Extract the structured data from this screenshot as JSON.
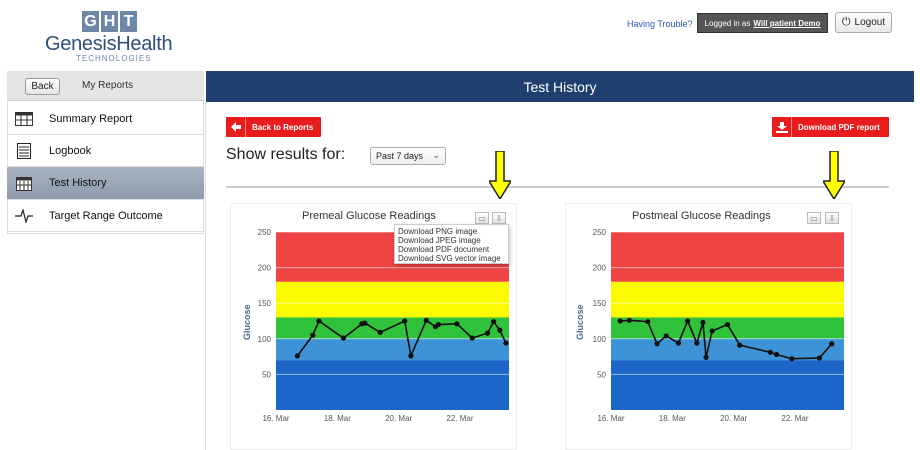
{
  "brand": {
    "mark": [
      "G",
      "H",
      "T"
    ],
    "name": "GenesisHealth",
    "sub": "TECHNOLOGIES"
  },
  "header": {
    "help": "Having Trouble?",
    "login_prefix": "Logged in as",
    "login_name": "Will patient Demo",
    "logout": "Logout"
  },
  "sidebar": {
    "back": "Back",
    "title": "My Reports",
    "items": [
      {
        "label": "Summary Report",
        "icon": "table-icon",
        "active": false
      },
      {
        "label": "Logbook",
        "icon": "notebook-icon",
        "active": false
      },
      {
        "label": "Test History",
        "icon": "calendar-icon",
        "active": true
      },
      {
        "label": "Target Range Outcome",
        "icon": "pulse-icon",
        "active": false
      }
    ]
  },
  "main": {
    "title": "Test History",
    "back_reports": "Back to Reports",
    "download_pdf": "Download PDF report",
    "show_label": "Show results for:",
    "range_value": "Past 7 days"
  },
  "export_menu": [
    "Download PNG image",
    "Download JPEG image",
    "Download PDF document",
    "Download SVG vector image"
  ],
  "colors": {
    "red": "#ef4444",
    "yellow": "#fafa00",
    "green": "#2fc23a",
    "lightblue": "#3d93d6",
    "blue": "#1c66c9",
    "header": "#1f3f6e"
  },
  "chart_data": [
    {
      "type": "line",
      "title": "Premeal Glucose Readings",
      "ylabel": "Glucose",
      "ylim": [
        0,
        250
      ],
      "yticks": [
        "250",
        "200",
        "150",
        "100",
        "50"
      ],
      "xticks": [
        "16. Mar",
        "18. Mar",
        "20. Mar",
        "22. Mar"
      ],
      "bands": [
        {
          "from": 180,
          "to": 250,
          "color": "red"
        },
        {
          "from": 130,
          "to": 180,
          "color": "yellow"
        },
        {
          "from": 100,
          "to": 130,
          "color": "green"
        },
        {
          "from": 70,
          "to": 100,
          "color": "lightblue"
        },
        {
          "from": 0,
          "to": 70,
          "color": "blue"
        }
      ],
      "x": [
        16.7,
        17.2,
        17.4,
        18.2,
        18.8,
        18.9,
        19.4,
        20.2,
        20.4,
        20.9,
        21.2,
        21.3,
        21.9,
        22.4,
        22.9,
        23.1,
        23.3,
        23.5
      ],
      "values": [
        76,
        105,
        125,
        101,
        121,
        122,
        109,
        125,
        76,
        126,
        117,
        120,
        121,
        101,
        108,
        124,
        112,
        94
      ]
    },
    {
      "type": "line",
      "title": "Postmeal Glucose Readings",
      "ylabel": "Glucose",
      "ylim": [
        0,
        250
      ],
      "yticks": [
        "250",
        "200",
        "150",
        "100",
        "50"
      ],
      "xticks": [
        "16. Mar",
        "18. Mar",
        "20. Mar",
        "22. Mar"
      ],
      "bands": [
        {
          "from": 180,
          "to": 250,
          "color": "red"
        },
        {
          "from": 130,
          "to": 180,
          "color": "yellow"
        },
        {
          "from": 100,
          "to": 130,
          "color": "green"
        },
        {
          "from": 70,
          "to": 100,
          "color": "lightblue"
        },
        {
          "from": 0,
          "to": 70,
          "color": "blue"
        }
      ],
      "x": [
        16.3,
        16.6,
        17.2,
        17.5,
        17.8,
        18.2,
        18.5,
        18.8,
        19.0,
        19.1,
        19.3,
        19.8,
        20.2,
        21.2,
        21.4,
        21.9,
        22.8,
        23.2
      ],
      "values": [
        125,
        126,
        124,
        93,
        104,
        94,
        125,
        94,
        123,
        74,
        111,
        120,
        91,
        81,
        78,
        72,
        73,
        93
      ]
    }
  ]
}
